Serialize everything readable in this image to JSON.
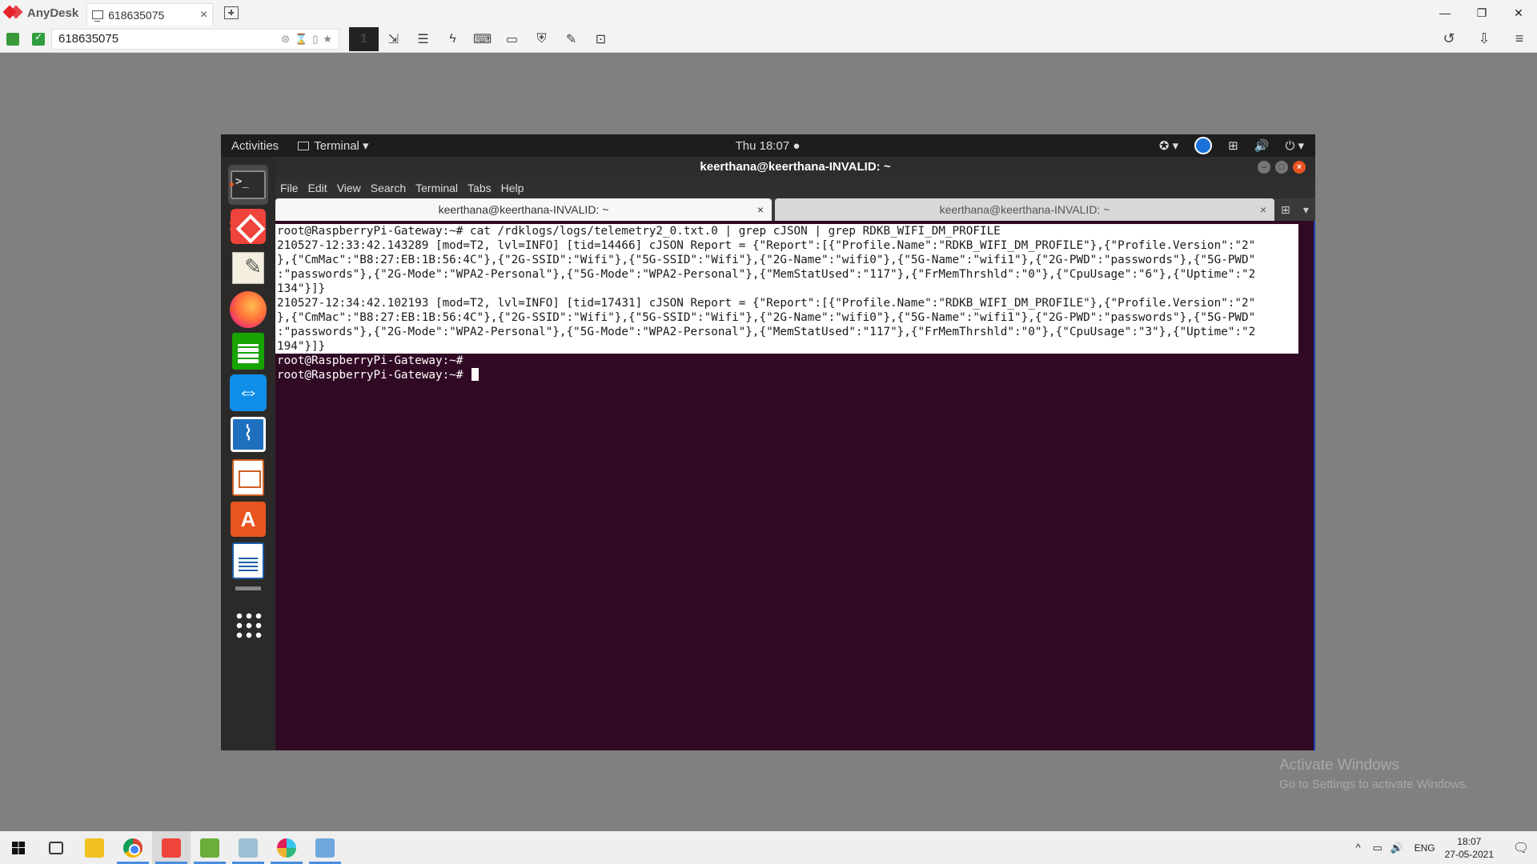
{
  "anydesk": {
    "brand": "AnyDesk",
    "tab_title": "618635075",
    "tab_close": "×",
    "address": "618635075",
    "address_icons": [
      "⊜",
      "⌛",
      "▯",
      "★"
    ],
    "monitor_label": "1",
    "toolbar_icons": [
      "⇲",
      "☰",
      "ϟ",
      "⌨",
      "▭",
      "⛨",
      "✎",
      "⊡"
    ],
    "right_icons": [
      "↺",
      "⇩",
      "≡"
    ],
    "window_controls": [
      "—",
      "❐",
      "✕"
    ],
    "accent": "#e4252a"
  },
  "ubuntu": {
    "activities": "Activities",
    "app_menu": "Terminal ▾",
    "clock": "Thu 18:07 ●",
    "tray": [
      "✪ ▾",
      "⊞",
      "🔊",
      "⏻ ▾"
    ]
  },
  "terminal": {
    "window_title": "keerthana@keerthana-INVALID: ~",
    "window_buttons": [
      "–",
      "□",
      "×"
    ],
    "menu": [
      "File",
      "Edit",
      "View",
      "Search",
      "Terminal",
      "Tabs",
      "Help"
    ],
    "tabs": [
      {
        "label": "keerthana@keerthana-INVALID: ~",
        "close": "×"
      },
      {
        "label": "keerthana@keerthana-INVALID: ~",
        "close": "×"
      }
    ],
    "tab_extra": [
      "⊞",
      "▾"
    ],
    "lines": [
      "root@RaspberryPi-Gateway:~# cat /rdklogs/logs/telemetry2_0.txt.0 | grep cJSON | grep RDKB_WIFI_DM_PROFILE",
      "210527-12:33:42.143289 [mod=T2, lvl=INFO] [tid=14466] cJSON Report = {\"Report\":[{\"Profile.Name\":\"RDKB_WIFI_DM_PROFILE\"},{\"Profile.Version\":\"2\"",
      "},{\"CmMac\":\"B8:27:EB:1B:56:4C\"},{\"2G-SSID\":\"Wifi\"},{\"5G-SSID\":\"Wifi\"},{\"2G-Name\":\"wifi0\"},{\"5G-Name\":\"wifi1\"},{\"2G-PWD\":\"passwords\"},{\"5G-PWD\"",
      ":\"passwords\"},{\"2G-Mode\":\"WPA2-Personal\"},{\"5G-Mode\":\"WPA2-Personal\"},{\"MemStatUsed\":\"117\"},{\"FrMemThrshld\":\"0\"},{\"CpuUsage\":\"6\"},{\"Uptime\":\"2",
      "134\"}]}",
      "210527-12:34:42.102193 [mod=T2, lvl=INFO] [tid=17431] cJSON Report = {\"Report\":[{\"Profile.Name\":\"RDKB_WIFI_DM_PROFILE\"},{\"Profile.Version\":\"2\"",
      "},{\"CmMac\":\"B8:27:EB:1B:56:4C\"},{\"2G-SSID\":\"Wifi\"},{\"5G-SSID\":\"Wifi\"},{\"2G-Name\":\"wifi0\"},{\"5G-Name\":\"wifi1\"},{\"2G-PWD\":\"passwords\"},{\"5G-PWD\"",
      ":\"passwords\"},{\"2G-Mode\":\"WPA2-Personal\"},{\"5G-Mode\":\"WPA2-Personal\"},{\"MemStatUsed\":\"117\"},{\"FrMemThrshld\":\"0\"},{\"CpuUsage\":\"3\"},{\"Uptime\":\"2",
      "194\"}]}",
      "root@RaspberryPi-Gateway:~#",
      "root@RaspberryPi-Gateway:~# "
    ],
    "bg_color": "#300a24"
  },
  "watermark": {
    "title": "Activate Windows",
    "subtitle": "Go to Settings to activate Windows."
  },
  "taskbar": {
    "tray_icons": [
      "^",
      "▭",
      "🔊"
    ],
    "language": "ENG",
    "time": "18:07",
    "date": "27-05-2021",
    "notification_icon": "🗨"
  }
}
